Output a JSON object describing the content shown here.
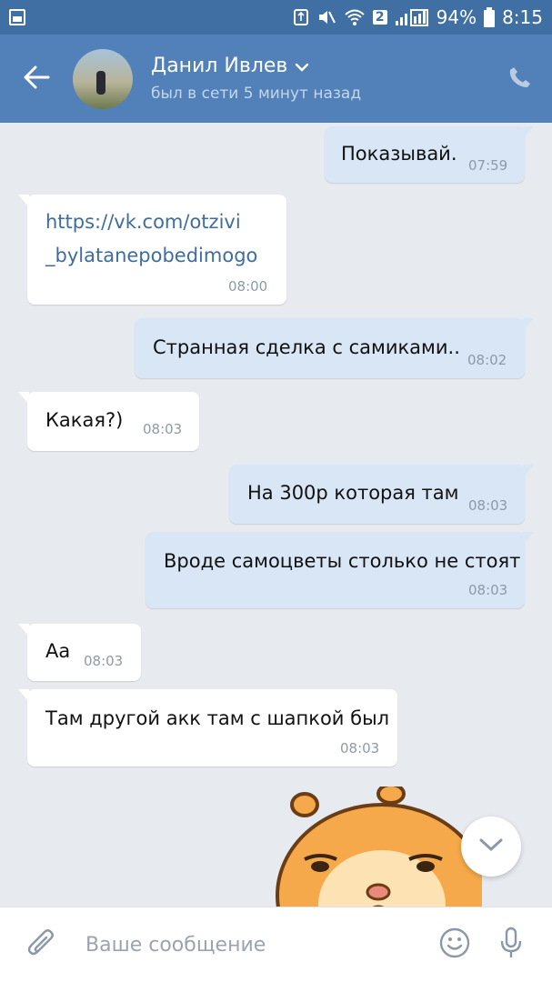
{
  "status_bar": {
    "sim_badge": "2",
    "battery": "94%",
    "time": "8:15"
  },
  "header": {
    "name": "Данил Ивлев",
    "status": "был в сети 5 минут назад"
  },
  "messages": [
    {
      "dir": "out",
      "text": "Показывай.",
      "time": "07:59"
    },
    {
      "dir": "in",
      "line1": "https://vk.com/otzivi",
      "line2": "_bylatanepobedimogo",
      "time": "08:00"
    },
    {
      "dir": "out",
      "text": "Странная сделка с самиками..",
      "time": "08:02"
    },
    {
      "dir": "in",
      "text": "Какая?)",
      "time": "08:03"
    },
    {
      "dir": "out",
      "text": "На 300р которая там",
      "time": "08:03"
    },
    {
      "dir": "out",
      "text": "Вроде самоцветы столько не стоят",
      "time": "08:03"
    },
    {
      "dir": "in",
      "text": "Аа",
      "time": "08:03"
    },
    {
      "dir": "in",
      "text": "Там другой акк там с шапкой был",
      "time": "08:03"
    }
  ],
  "composer": {
    "placeholder": "Ваше сообщение"
  },
  "colors": {
    "status_bar": "#3f6fa3",
    "header": "#5181b8",
    "chat_bg": "#e7ebf0",
    "outgoing_bubble": "#d9e6f5",
    "incoming_bubble": "#ffffff",
    "link": "#3e6d9e"
  },
  "icons": [
    "image-icon",
    "sync-icon",
    "mute-icon",
    "wifi-icon",
    "signal-icon",
    "battery-icon",
    "back-arrow-icon",
    "chevron-down-icon",
    "phone-icon",
    "paperclip-icon",
    "smile-icon",
    "microphone-icon"
  ]
}
